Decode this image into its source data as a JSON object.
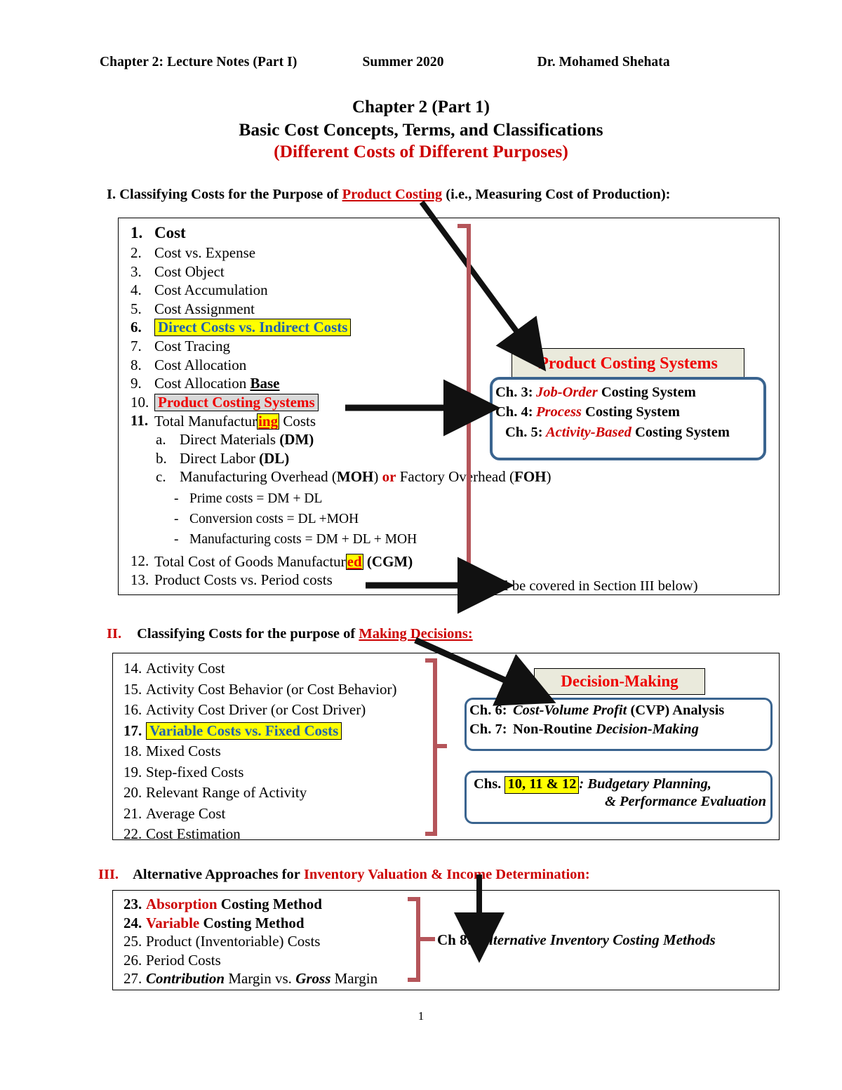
{
  "header": {
    "left": "Chapter 2: Lecture Notes (Part I)",
    "middle": "Summer 2020",
    "right": "Dr. Mohamed Shehata"
  },
  "title": {
    "line1": "Chapter 2 (Part 1)",
    "line2": "Basic Cost Concepts, Terms, and Classifications",
    "line3": "(Different Costs of Different Purposes)",
    "line3_color": "#CC0000"
  },
  "section1": {
    "heading_num": "I.",
    "heading_pre": "Classifying Costs for the Purpose of",
    "heading_emph": "Product Costing",
    "heading_post": "(i.e., Measuring Cost of Production):",
    "items": [
      {
        "n": "1.",
        "text": "Cost"
      },
      {
        "n": "2.",
        "text": "Cost vs. Expense"
      },
      {
        "n": "3.",
        "text": "Cost Object"
      },
      {
        "n": "4.",
        "text": "Cost Accumulation"
      },
      {
        "n": "5.",
        "text": "Cost Assignment"
      },
      {
        "n": "6.",
        "text": "Direct Costs vs. Indirect Costs"
      },
      {
        "n": "7.",
        "text": "Cost Tracing"
      },
      {
        "n": "8.",
        "text": "Cost Allocation"
      },
      {
        "n": "9.",
        "text": "Cost Allocation Base",
        "plain": "Cost Allocation ",
        "ul": "Base"
      },
      {
        "n": "10.",
        "text": "Product Costing Systems"
      },
      {
        "n": "11.",
        "pre": "Total Manufactur",
        "hl": "ing",
        "post": " Costs"
      },
      {
        "n": "a.",
        "text": "Direct Materials (DM)",
        "plain": "Direct Materials ",
        "bold": "(DM)"
      },
      {
        "n": "b.",
        "text": "Direct Labor (DL)",
        "plain": "Direct Labor ",
        "bold": "(DL)"
      },
      {
        "n": "c.",
        "text": "Manufacturing Overhead (MOH) or Factory Overhead (FOH)",
        "p1": "Manufacturing Overhead (",
        "b1": "MOH",
        "p2": ") ",
        "or": "or",
        "p3": " Factory Overhead (",
        "b2": "FOH",
        "p4": ")"
      },
      {
        "n": "-",
        "text": "Prime costs = DM + DL"
      },
      {
        "n": "-",
        "text": "Conversion costs = DL +MOH"
      },
      {
        "n": "-",
        "text": "Manufacturing costs = DM + DL + MOH"
      },
      {
        "n": "12.",
        "pre": "Total Cost of Manufactur",
        "hl": "ed",
        "post": " (CGM)",
        "full_pre": "Total Cost of Goods Manufactur",
        "full_post": " (CGM)"
      },
      {
        "n": "13.",
        "text": "Product Costs vs. Period costs"
      }
    ],
    "note": "(will be covered in Section III below)",
    "callout": {
      "title": "Product Costing Systems",
      "title_color": "#EE0000",
      "rows": [
        {
          "label": "Ch. 3:",
          "emph": "Job-Order",
          "rest": "Costing System"
        },
        {
          "label": "Ch. 4:",
          "emph": "Process",
          "rest": "Costing System"
        },
        {
          "label": "Ch. 5:",
          "emph": "Activity-Based",
          "rest": "Costing System"
        }
      ]
    }
  },
  "section2": {
    "heading_num": "II.",
    "heading_pre": "Classifying Costs for the purpose of",
    "heading_emph": "Making Decisions:",
    "items": [
      {
        "n": "14.",
        "text": "Activity Cost"
      },
      {
        "n": "15.",
        "text": "Activity Cost Behavior (or Cost Behavior)"
      },
      {
        "n": "16.",
        "text": "Activity Cost Driver (or Cost Driver)"
      },
      {
        "n": "17.",
        "text": "Variable Costs vs. Fixed Costs"
      },
      {
        "n": "18.",
        "text": "Mixed Costs"
      },
      {
        "n": "19.",
        "text": "Step-fixed Costs"
      },
      {
        "n": "20.",
        "text": "Relevant Range of Activity"
      },
      {
        "n": "21.",
        "text": "Average Cost"
      },
      {
        "n": "22.",
        "text": "Cost Estimation"
      }
    ],
    "callout": {
      "title": "Decision-Making",
      "title_color": "#EE0000",
      "rows": [
        {
          "label": "Ch. 6:",
          "emph": "Cost-Volume Profit",
          "rest": "(CVP) Analysis"
        },
        {
          "label": "Ch. 7:",
          "pre": "Non-Routine",
          "emph2": "Decision-Making"
        }
      ],
      "box2_prefix": "Chs.",
      "box2_chapters": "10, 11 & 12",
      "box2_suffix": ":  Budgetary Planning,",
      "box2_line2": "& Performance Evaluation"
    }
  },
  "section3": {
    "heading_num": "III.",
    "heading_pre": "Alternative Approaches for",
    "heading_emph": "Inventory Valuation & Income Determination:",
    "items": [
      {
        "n": "23.",
        "emph": "Absorption",
        "rest": "Costing Method"
      },
      {
        "n": "24.",
        "emph": "Variable",
        "rest": "Costing Method"
      },
      {
        "n": "25.",
        "text": "Product (Inventoriable) Costs"
      },
      {
        "n": "26.",
        "text": "Period Costs"
      },
      {
        "n": "27.",
        "text": "Contribution Margin vs. Gross Margin",
        "it1": "Contribution",
        "mid": " Margin vs. ",
        "it2": "Gross",
        "tail": " Margin"
      }
    ],
    "ch8_label": "Ch 8:",
    "ch8_emph": "Alternative Inventory Costing Methods"
  },
  "page_number": "1",
  "colors": {
    "accent_red": "#CC0000",
    "bright_red": "#EE0000",
    "highlight_yellow": "#FFFF00",
    "link_blue": "#1F62B0",
    "box_blue": "#3A648F",
    "brace_red": "#B5555A",
    "callout_bg": "#EAEADC",
    "gray_chip": "#D9D9D9"
  }
}
